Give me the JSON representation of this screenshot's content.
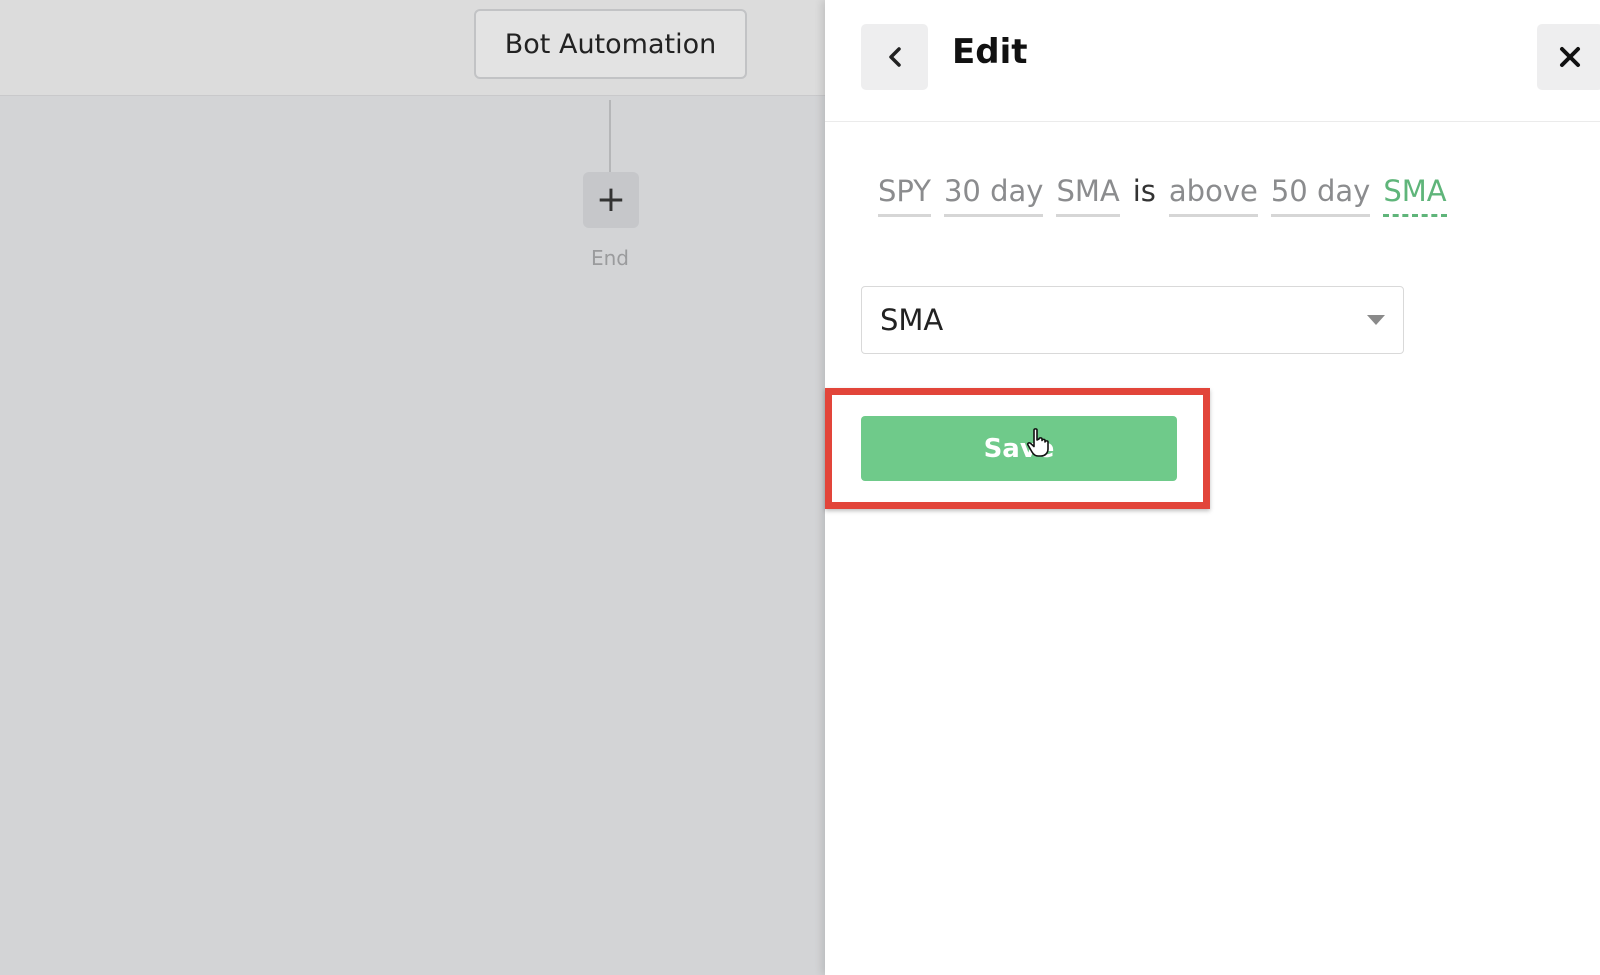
{
  "canvas": {
    "title_node": "Bot Automation",
    "add_symbol": "+",
    "end_label": "End"
  },
  "panel": {
    "title": "Edit",
    "back_icon": "chevron-left-icon",
    "close_icon": "close-icon",
    "condition_tokens": [
      "SPY",
      "30 day",
      "SMA",
      "is",
      "above",
      "50 day",
      "SMA"
    ],
    "select": {
      "value": "SMA",
      "caret_icon": "caret-down-icon"
    },
    "save_label": "Save"
  },
  "colors": {
    "accent_green": "#6fca8a",
    "active_token": "#5fb57a",
    "highlight_red": "#e2453a"
  }
}
